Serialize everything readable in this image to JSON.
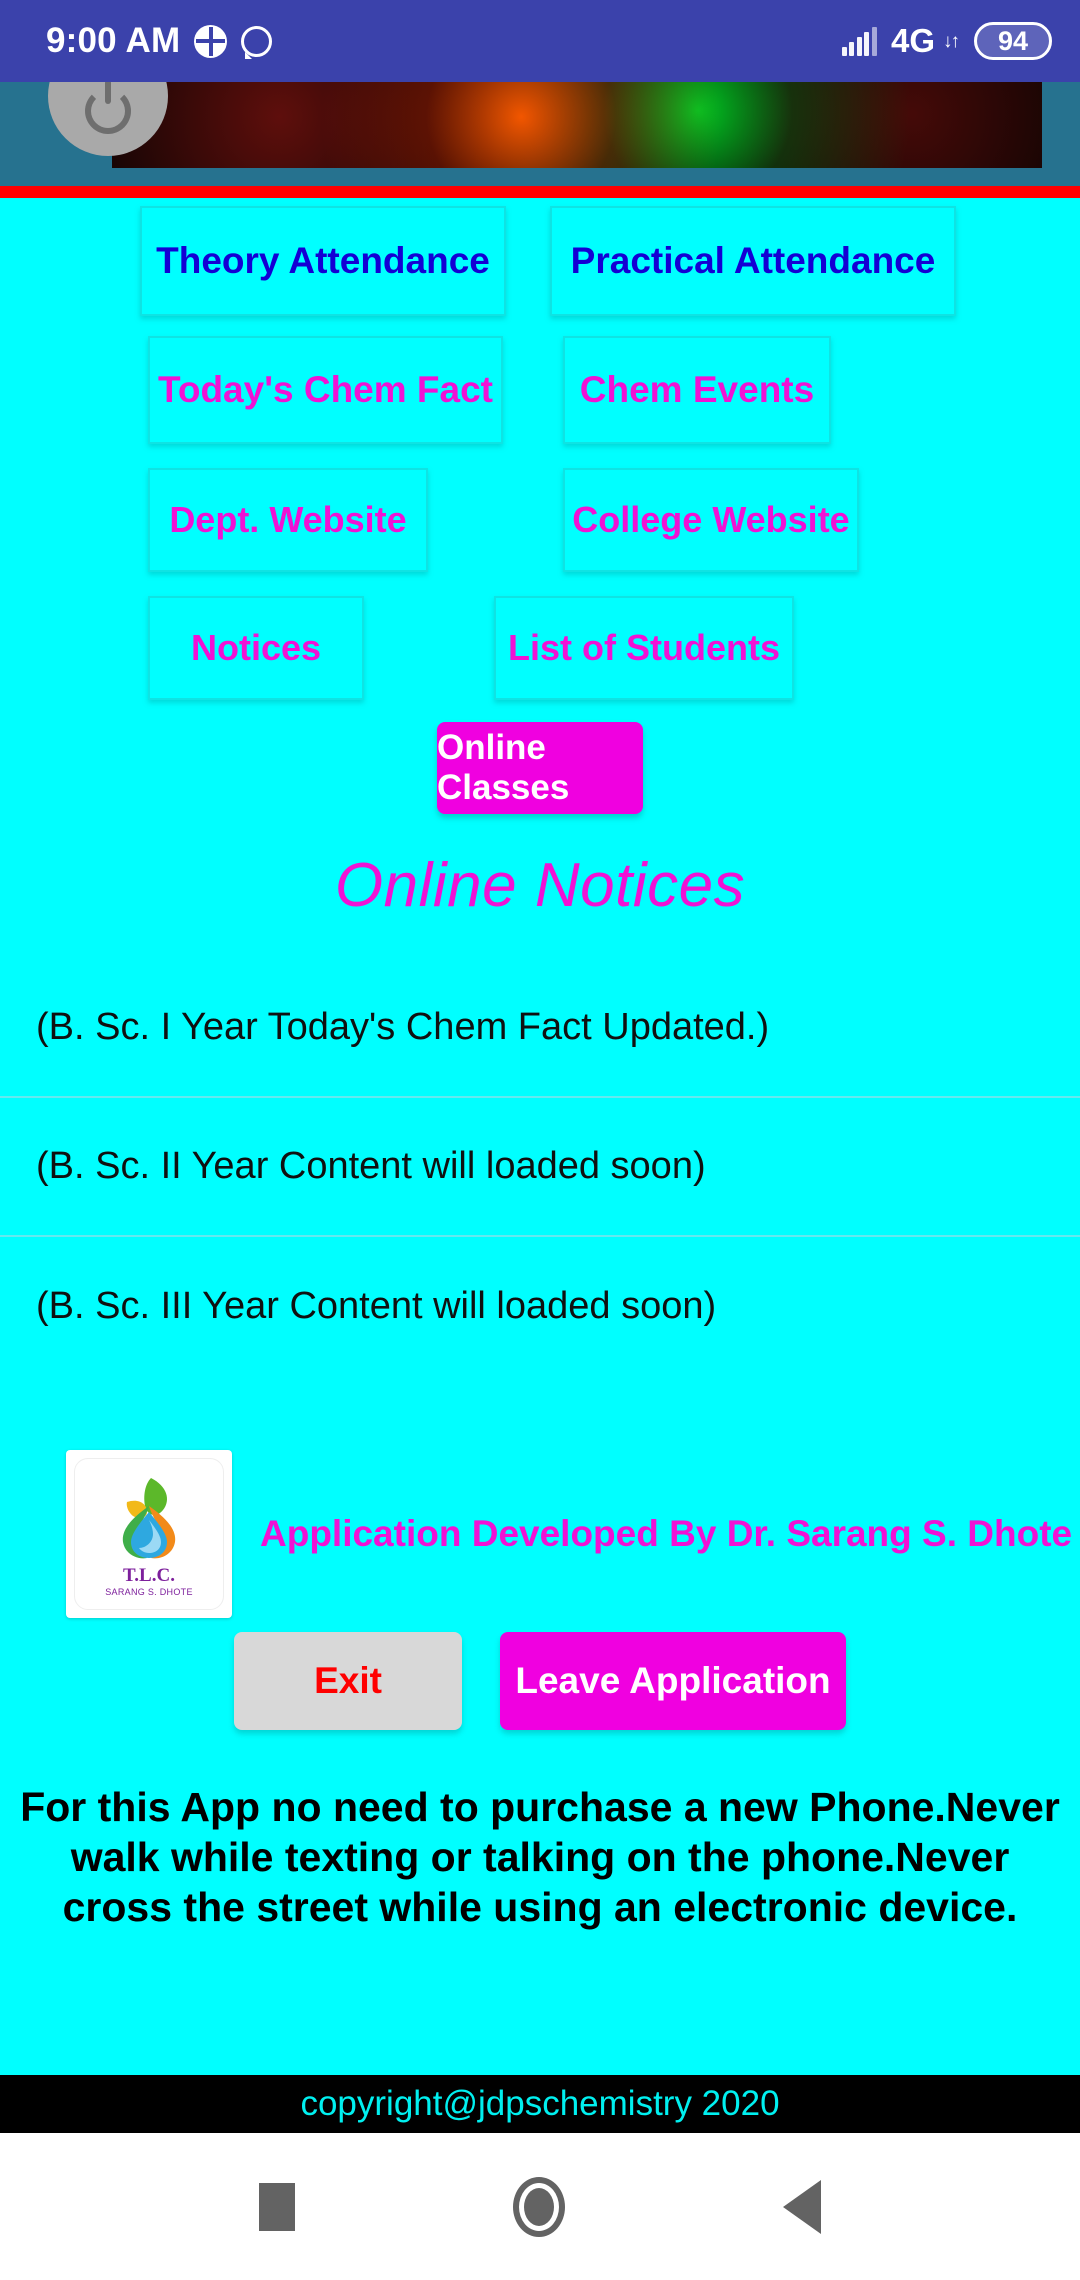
{
  "status_bar": {
    "time": "9:00 AM",
    "icons": [
      "app-grid-icon",
      "whatsapp-icon"
    ],
    "network_label": "4G",
    "network_arrows": "↓↑",
    "battery_level": "94"
  },
  "banner": {
    "avatar_icon": "power-avatar-icon",
    "image_alt": "flame-test-spectrum-banner"
  },
  "buttons": {
    "theory_attendance": "Theory Attendance",
    "practical_attendance": "Practical Attendance",
    "todays_chem_fact": "Today's Chem Fact",
    "chem_events": "Chem Events",
    "dept_website": "Dept. Website",
    "college_website": "College Website",
    "notices": "Notices",
    "list_of_students": "List of Students",
    "online_classes": "Online Classes"
  },
  "notices_section": {
    "heading": "Online Notices",
    "items": [
      "(B. Sc. I Year Today's Chem Fact Updated.)",
      "(B. Sc. II Year Content will loaded soon)",
      "(B. Sc. III Year Content will loaded soon)"
    ]
  },
  "credit": {
    "text": "Application Developed By Dr. Sarang S. Dhote",
    "logo_title": "T.L.C.",
    "logo_subtitle": "SARANG S. DHOTE"
  },
  "actions": {
    "exit": "Exit",
    "leave_application": "Leave Application"
  },
  "safety_message": "For this  App no need to purchase a new Phone.Never walk while texting or talking on the phone.Never cross the street while using an electronic device.",
  "footer": {
    "copyright": "copyright@jdpschemistry 2020"
  },
  "nav_bar": {
    "recents": "recents-square-icon",
    "home": "home-circle-icon",
    "back": "back-triangle-icon"
  },
  "colors": {
    "background": "#00ffff",
    "status_bar": "#3b42ab",
    "banner": "#26728f",
    "accent_magenta": "#f012d4",
    "button_magenta": "#f000e0",
    "link_blue": "#1400d4",
    "divider_red": "#ff0000",
    "footer_black": "#000000",
    "exit_red": "#ff0000"
  }
}
